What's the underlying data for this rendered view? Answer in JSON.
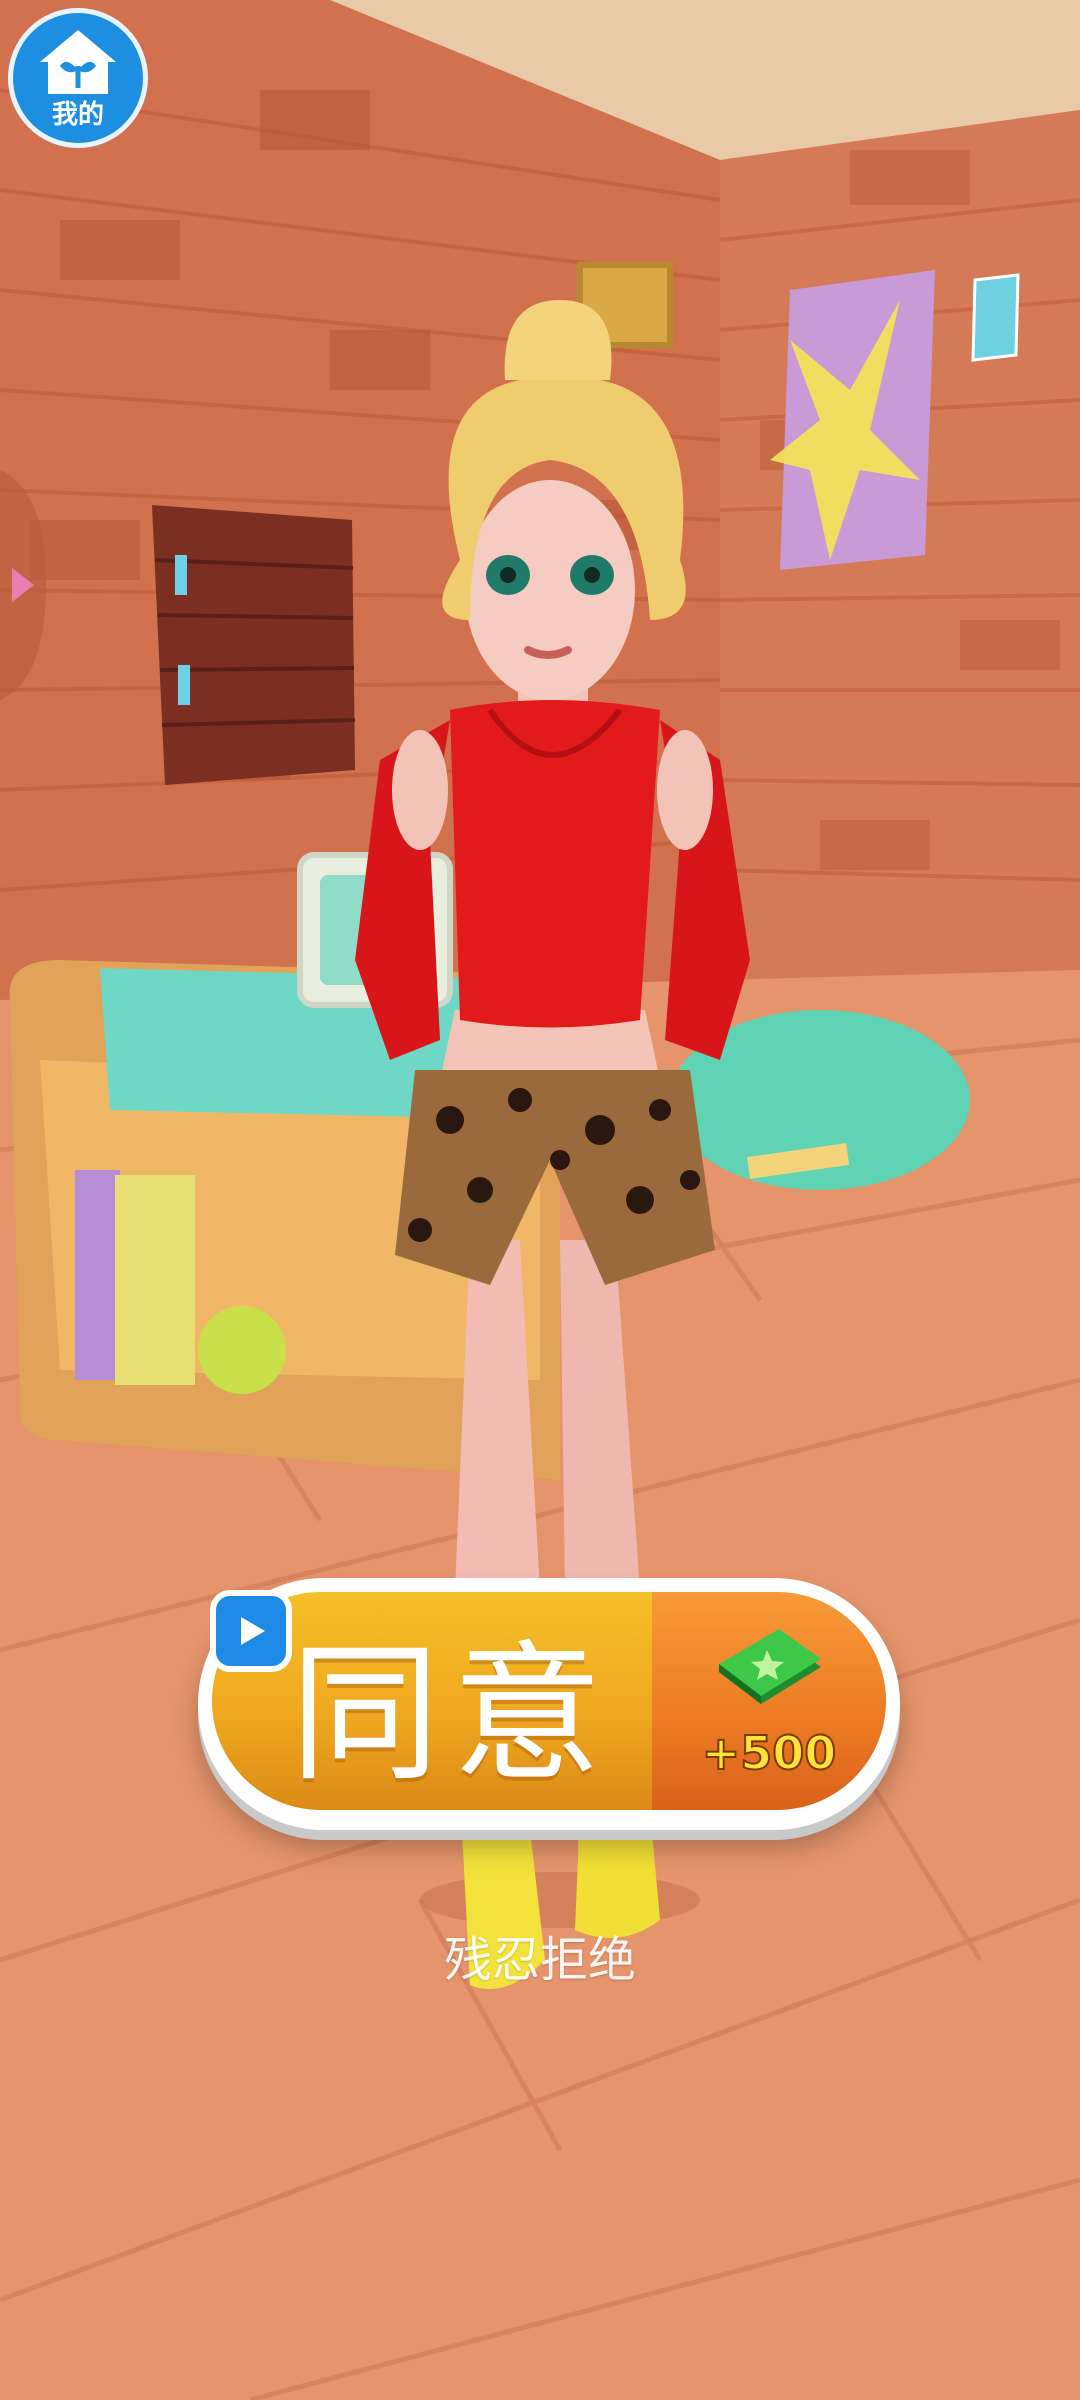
{
  "home": {
    "label": "我的",
    "icon": "house-sprout-icon"
  },
  "side_tab": {
    "icon": "chevron-right-icon"
  },
  "agree_button": {
    "label": "同意",
    "reward": "+500",
    "video_icon": "play-video-icon",
    "reward_icon": "cash-stack-icon"
  },
  "refuse_link": {
    "label": "残忍拒绝"
  },
  "colors": {
    "wall": "#d1714e",
    "floor": "#e5946b",
    "ceiling": "#e9caa6",
    "button_yellow": "#f0a820",
    "button_orange": "#ec7a22",
    "accent_blue": "#1e8fe0"
  }
}
